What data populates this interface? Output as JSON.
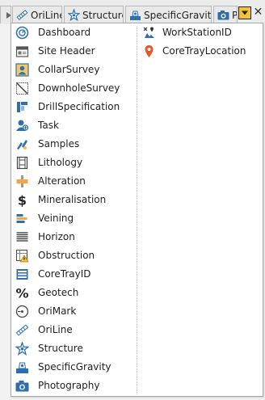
{
  "tabs": [
    {
      "label": "",
      "icon": "chevron-icon"
    },
    {
      "label": "OriLine",
      "icon": "oriline-icon"
    },
    {
      "label": "Structure",
      "icon": "structure-icon"
    },
    {
      "label": "SpecificGravity",
      "icon": "specific-gravity-icon"
    },
    {
      "label": "P",
      "icon": "camera-icon"
    }
  ],
  "menu": {
    "column1": [
      {
        "label": "Dashboard",
        "icon": "dashboard-icon"
      },
      {
        "label": "Site Header",
        "icon": "site-header-icon"
      },
      {
        "label": "CollarSurvey",
        "icon": "collar-survey-icon"
      },
      {
        "label": "DownholeSurvey",
        "icon": "downhole-survey-icon"
      },
      {
        "label": "DrillSpecification",
        "icon": "drill-specification-icon"
      },
      {
        "label": "Task",
        "icon": "task-icon"
      },
      {
        "label": "Samples",
        "icon": "samples-icon"
      },
      {
        "label": "Lithology",
        "icon": "lithology-icon"
      },
      {
        "label": "Alteration",
        "icon": "alteration-icon"
      },
      {
        "label": "Mineralisation",
        "icon": "dollar-icon"
      },
      {
        "label": "Veining",
        "icon": "veining-icon"
      },
      {
        "label": "Horizon",
        "icon": "horizon-icon"
      },
      {
        "label": "Obstruction",
        "icon": "obstruction-icon"
      },
      {
        "label": "CoreTrayID",
        "icon": "core-tray-icon"
      },
      {
        "label": "Geotech",
        "icon": "percent-icon"
      },
      {
        "label": "OriMark",
        "icon": "orimark-icon"
      },
      {
        "label": "OriLine",
        "icon": "oriline-icon"
      },
      {
        "label": "Structure",
        "icon": "structure-icon"
      },
      {
        "label": "SpecificGravity",
        "icon": "specific-gravity-icon"
      },
      {
        "label": "Photography",
        "icon": "camera-icon"
      }
    ],
    "column2": [
      {
        "label": "WorkStationID",
        "icon": "workstation-icon"
      },
      {
        "label": "CoreTrayLocation",
        "icon": "map-pin-icon"
      }
    ]
  },
  "colors": {
    "accent_blue": "#2f6fb0",
    "dropdown_yellow": "#f2c23a",
    "pin_orange": "#e2572b"
  }
}
